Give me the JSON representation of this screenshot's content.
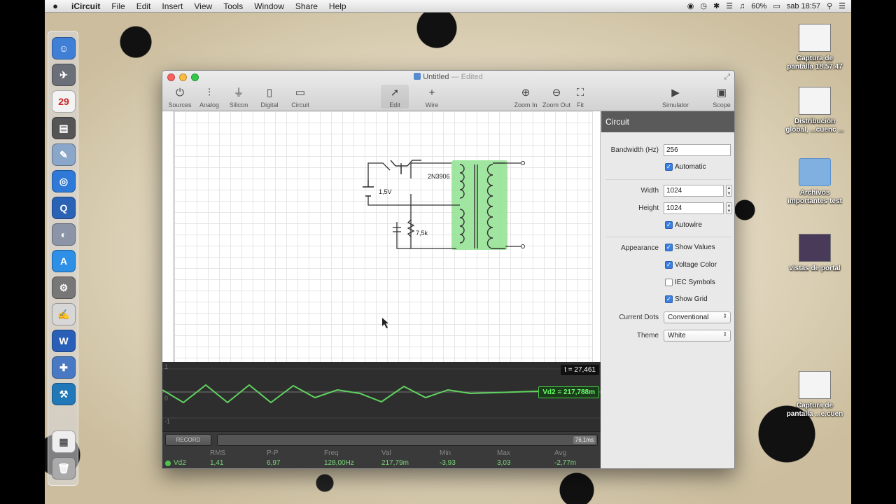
{
  "menubar": {
    "apple": "",
    "app_name": "iCircuit",
    "items": [
      "File",
      "Edit",
      "Insert",
      "View",
      "Tools",
      "Window",
      "Share",
      "Help"
    ],
    "battery": "60%",
    "clock": "sab 18:57"
  },
  "desktop": {
    "icons": [
      {
        "label": "Captura de\npantalla 18.57.47"
      },
      {
        "label": "Distribución\nglobal, ...cuenc ..."
      },
      {
        "label": "Archivos\nimportantes test"
      },
      {
        "label": "vistas de portal"
      },
      {
        "label": "Captura de\npantalla ...e.cuen"
      }
    ]
  },
  "window": {
    "title": "Untitled",
    "edited": "— Edited",
    "toolbar": {
      "sources": "Sources",
      "analog": "Analog",
      "silicon": "Silicon",
      "digital": "Digital",
      "circuit": "Circuit",
      "edit": "Edit",
      "wire": "Wire",
      "zoom_in": "Zoom In",
      "zoom_out": "Zoom Out",
      "fit": "Fit",
      "simulator": "Simulator",
      "scope": "Scope"
    }
  },
  "circuit": {
    "battery_label": "1,5V",
    "transistor_label": "2N3906",
    "resistor_label": "7,5k"
  },
  "scope": {
    "time": "t = 27,461",
    "probe_value": "Vd2 = 217,788m",
    "axis_top": "1",
    "axis_mid": "0",
    "axis_bot": "-1",
    "record_label": "RECORD",
    "time_window": "76,1ms",
    "channel": "Vd2",
    "stats": [
      {
        "header": "RMS",
        "value": "1,41"
      },
      {
        "header": "P-P",
        "value": "6,97"
      },
      {
        "header": "Freq",
        "value": "128,00Hz"
      },
      {
        "header": "Val",
        "value": "217,79m"
      },
      {
        "header": "Min",
        "value": "-3,93"
      },
      {
        "header": "Max",
        "value": "3,03"
      },
      {
        "header": "Avg",
        "value": "-2,77m"
      }
    ],
    "waveform_color": "#5fd35f"
  },
  "inspector": {
    "title": "Circuit",
    "bandwidth_label": "Bandwidth (Hz)",
    "bandwidth_value": "256",
    "automatic_label": "Automatic",
    "width_label": "Width",
    "width_value": "1024",
    "height_label": "Height",
    "height_value": "1024",
    "autowire_label": "Autowire",
    "appearance_label": "Appearance",
    "show_values_label": "Show Values",
    "voltage_color_label": "Voltage Color",
    "iec_symbols_label": "IEC Symbols",
    "show_grid_label": "Show Grid",
    "current_dots_label": "Current Dots",
    "current_dots_value": "Conventional",
    "theme_label": "Theme",
    "theme_value": "White"
  }
}
